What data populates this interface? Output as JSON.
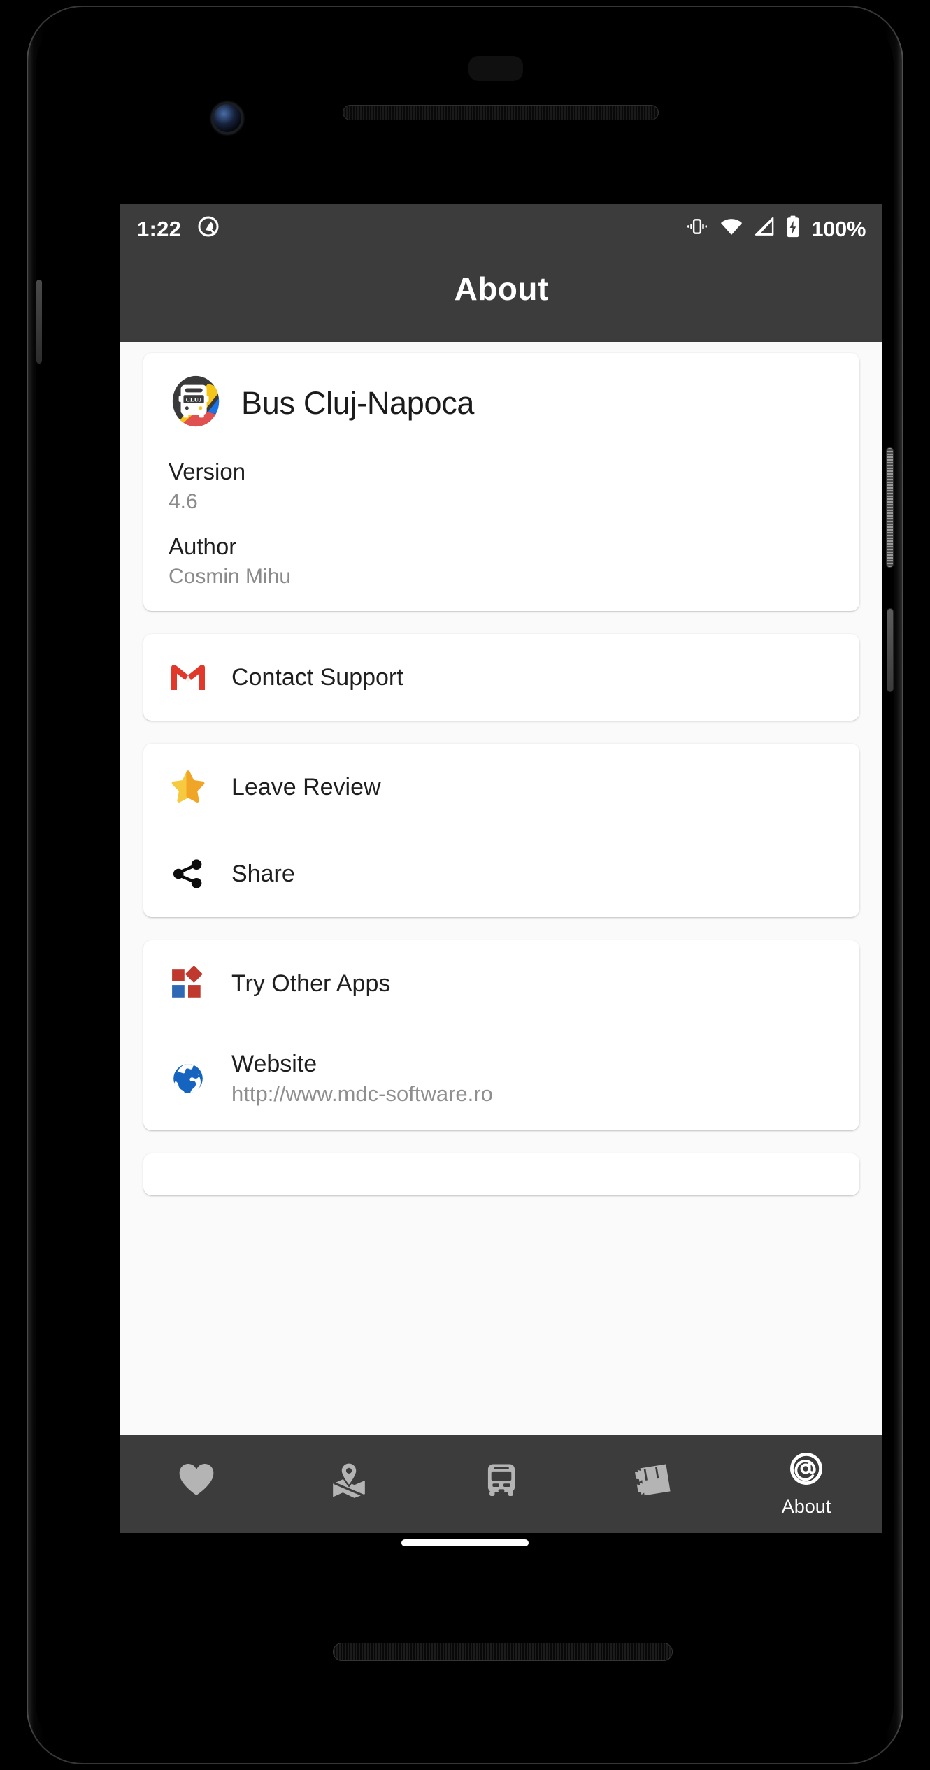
{
  "status_bar": {
    "clock": "1:22",
    "battery_percent": "100%",
    "icons": [
      "do-not-disturb-icon",
      "vibrate-icon",
      "wifi-icon",
      "cellular-signal-icon",
      "battery-charging-icon"
    ]
  },
  "app_bar": {
    "title": "About"
  },
  "app_info": {
    "app_name": "Bus Cluj-Napoca",
    "icon_label": "CLUJ",
    "rows": [
      {
        "label": "Version",
        "value": "4.6"
      },
      {
        "label": "Author",
        "value": "Cosmin Mihu"
      }
    ]
  },
  "support_card": {
    "rows": [
      {
        "icon": "gmail-icon",
        "title": "Contact Support"
      }
    ]
  },
  "engagement_card": {
    "rows": [
      {
        "icon": "star-icon",
        "title": "Leave Review"
      },
      {
        "icon": "share-icon",
        "title": "Share"
      }
    ]
  },
  "links_card": {
    "rows": [
      {
        "icon": "other-apps-icon",
        "title": "Try Other Apps",
        "sub": ""
      },
      {
        "icon": "globe-icon",
        "title": "Website",
        "sub": "http://www.mdc-software.ro"
      }
    ]
  },
  "bottom_nav": {
    "items": [
      {
        "icon": "heart-icon",
        "label": "",
        "active": false
      },
      {
        "icon": "map-pin-icon",
        "label": "",
        "active": false
      },
      {
        "icon": "bus-icon",
        "label": "",
        "active": false
      },
      {
        "icon": "ticket-icon",
        "label": "",
        "active": false
      },
      {
        "icon": "at-sign-icon",
        "label": "About",
        "active": true
      }
    ],
    "active_label": "About"
  },
  "colors": {
    "chrome": "#3c3c3c",
    "page_background": "#fafafa",
    "card": "#ffffff",
    "gmail_red": "#e0392b",
    "star_yellow": "#f7c142",
    "globe_blue": "#1565c0",
    "apps_red": "#c0392e",
    "apps_blue": "#2f68b5",
    "nav_inactive": "#b4b4b4",
    "nav_active": "#ffffff"
  }
}
